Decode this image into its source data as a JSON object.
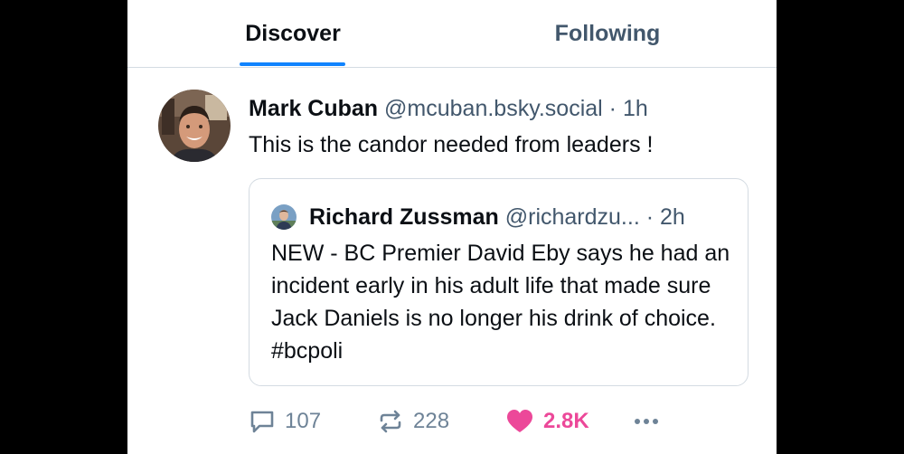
{
  "tabs": [
    {
      "label": "Discover",
      "active": true
    },
    {
      "label": "Following",
      "active": false
    }
  ],
  "post": {
    "author_name": "Mark Cuban",
    "author_handle": "@mcuban.bsky.social",
    "separator": " · ",
    "time": "1h",
    "text": "This is the candor needed from leaders !"
  },
  "quote": {
    "author_name": "Richard Zussman",
    "author_handle": "@richardzu...",
    "separator": " · ",
    "time": "2h",
    "text": "NEW - BC Premier David Eby says he had an incident early in his adult life that made sure Jack Daniels is no longer his drink of choice. #bcpoli"
  },
  "actions": {
    "reply_count": "107",
    "repost_count": "228",
    "like_count": "2.8K",
    "liked": true,
    "reply_icon": "speech-bubble-icon",
    "repost_icon": "repost-arrows-icon",
    "like_icon": "heart-icon",
    "more_icon": "ellipsis-icon"
  },
  "colors": {
    "accent": "#1083fe",
    "like": "#ec4899",
    "muted_text": "#42576c",
    "action_gray": "#6e8397",
    "border": "#d4dbe2"
  }
}
